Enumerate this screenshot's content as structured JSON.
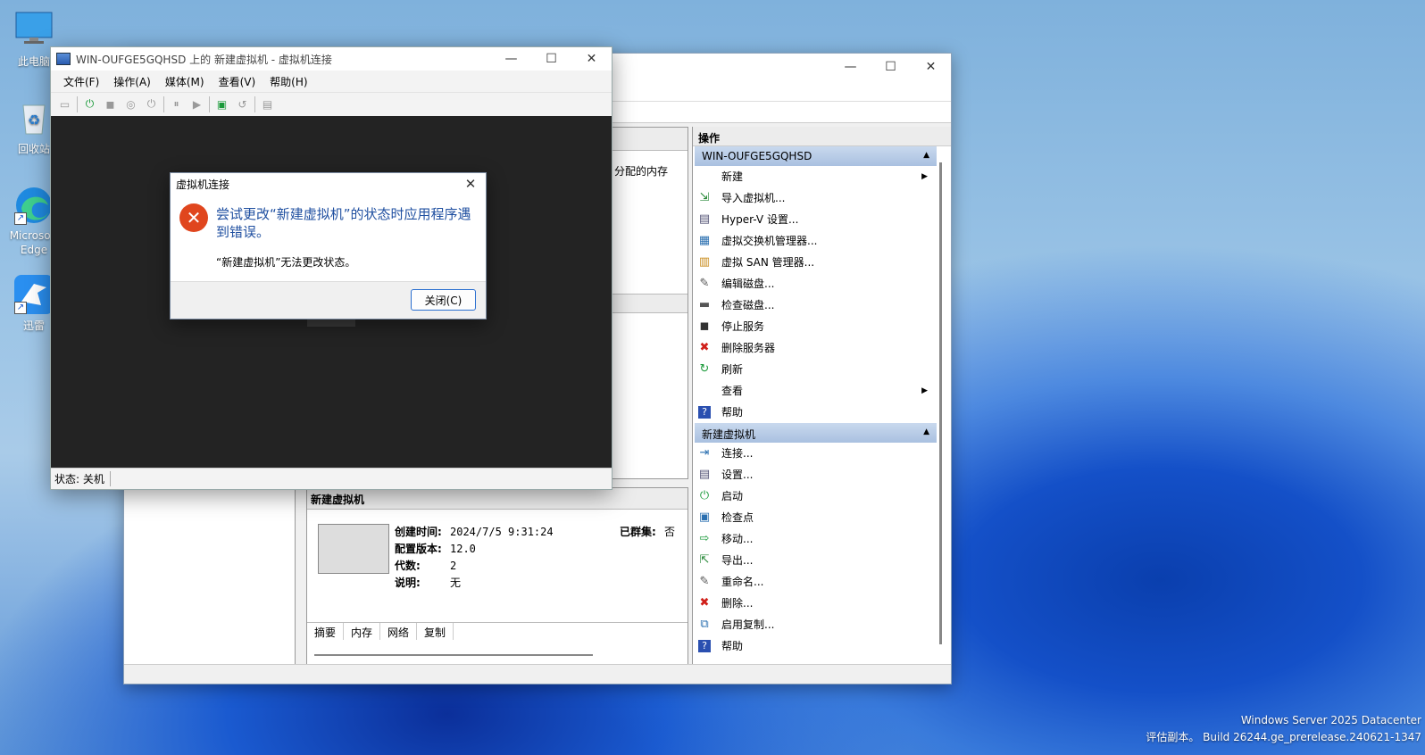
{
  "desktop": {
    "icons": [
      {
        "label": "此电脑"
      },
      {
        "label": "回收站"
      },
      {
        "label": "Microsoft Edge"
      },
      {
        "label": "迅雷"
      }
    ]
  },
  "vm_window": {
    "title": "WIN-OUFGE5GQHSD 上的 新建虚拟机 - 虚拟机连接",
    "menu": [
      "文件(F)",
      "操作(A)",
      "媒体(M)",
      "查看(V)",
      "帮助(H)"
    ],
    "status": "状态: 关机"
  },
  "dialog": {
    "title": "虚拟机连接",
    "main_text": "尝试更改“新建虚拟机”的状态时应用程序遇到错误。",
    "sub_text": "“新建虚拟机”无法更改状态。",
    "close_button": "关闭(C)"
  },
  "manager": {
    "center": {
      "memory_col": "分配的内存"
    },
    "details": {
      "title": "新建虚拟机",
      "created_label": "创建时间:",
      "created_value": "2024/7/5 9:31:24",
      "clustered_label": "已群集:",
      "clustered_value": "否",
      "version_label": "配置版本:",
      "version_value": "12.0",
      "generation_label": "代数:",
      "generation_value": "2",
      "notes_label": "说明:",
      "notes_value": "无",
      "tabs": [
        "摘要",
        "内存",
        "网络",
        "复制"
      ]
    },
    "actions": {
      "header": "操作",
      "server_group": "WIN-OUFGE5GQHSD",
      "server_items": [
        {
          "label": "新建",
          "icon": "blank",
          "submenu": true
        },
        {
          "label": "导入虚拟机...",
          "icon": "import-icon"
        },
        {
          "label": "Hyper-V 设置...",
          "icon": "settings-doc-icon"
        },
        {
          "label": "虚拟交换机管理器...",
          "icon": "switch-icon"
        },
        {
          "label": "虚拟 SAN 管理器...",
          "icon": "san-icon"
        },
        {
          "label": "编辑磁盘...",
          "icon": "edit-disk-icon"
        },
        {
          "label": "检查磁盘...",
          "icon": "inspect-disk-icon"
        },
        {
          "label": "停止服务",
          "icon": "stop-icon"
        },
        {
          "label": "删除服务器",
          "icon": "delete-x-icon"
        },
        {
          "label": "刷新",
          "icon": "refresh-icon"
        },
        {
          "label": "查看",
          "icon": "blank",
          "submenu": true
        },
        {
          "label": "帮助",
          "icon": "help-icon"
        }
      ],
      "vm_group": "新建虚拟机",
      "vm_items": [
        {
          "label": "连接...",
          "icon": "connect-icon"
        },
        {
          "label": "设置...",
          "icon": "settings-icon"
        },
        {
          "label": "启动",
          "icon": "power-icon"
        },
        {
          "label": "检查点",
          "icon": "checkpoint-icon"
        },
        {
          "label": "移动...",
          "icon": "move-icon"
        },
        {
          "label": "导出...",
          "icon": "export-icon"
        },
        {
          "label": "重命名...",
          "icon": "rename-icon"
        },
        {
          "label": "删除...",
          "icon": "delete-icon"
        },
        {
          "label": "启用复制...",
          "icon": "replicate-icon"
        },
        {
          "label": "帮助",
          "icon": "help-icon"
        }
      ]
    }
  },
  "watermark": {
    "line1": "Windows Server 2025 Datacenter",
    "line2": "评估副本。 Build 26244.ge_prerelease.240621-1347"
  }
}
